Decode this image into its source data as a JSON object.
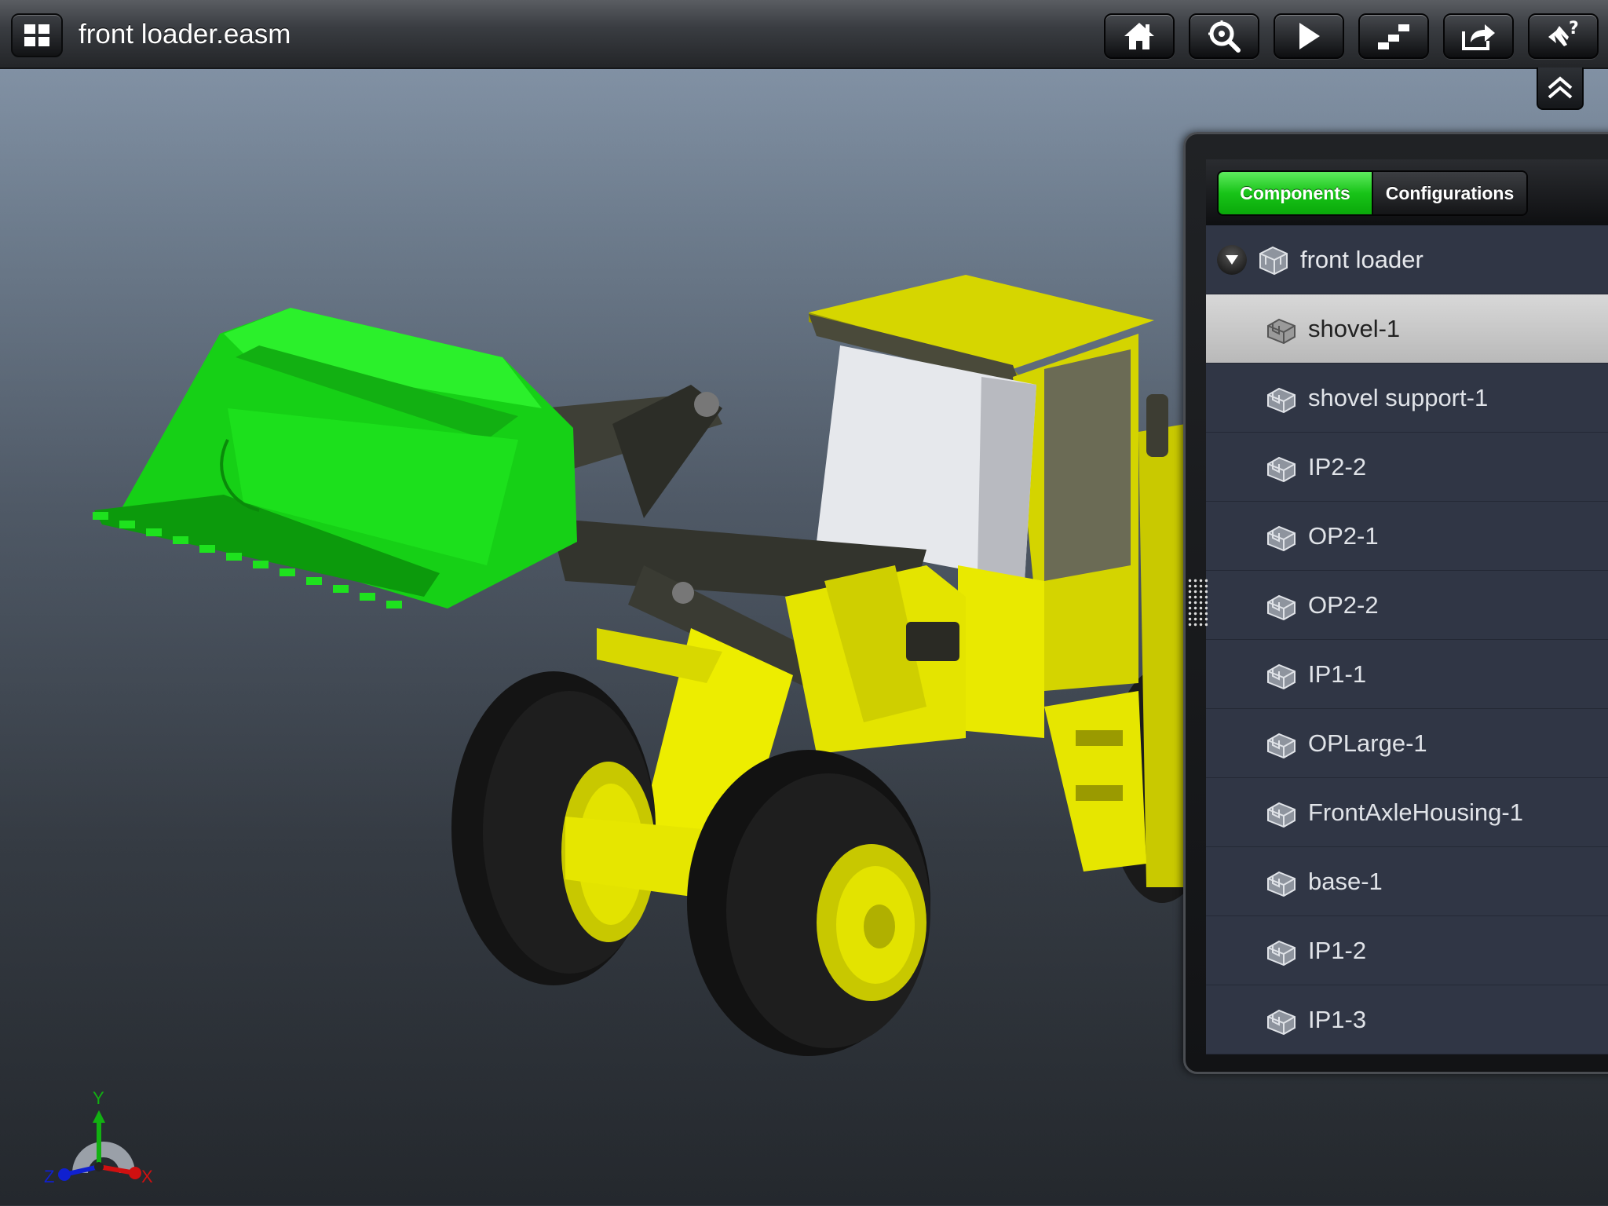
{
  "header": {
    "document_title": "front loader.easm",
    "buttons": [
      {
        "icon": "home-icon"
      },
      {
        "icon": "zoom-fit-icon"
      },
      {
        "icon": "play-icon"
      },
      {
        "icon": "explode-icon"
      },
      {
        "icon": "share-icon"
      },
      {
        "icon": "help-gesture-icon"
      }
    ]
  },
  "panel": {
    "tabs": {
      "components": "Components",
      "configurations": "Configurations",
      "active": "Components"
    },
    "root": {
      "label": "front loader",
      "expanded": true
    },
    "items": [
      {
        "label": "shovel-1",
        "selected": true
      },
      {
        "label": "shovel support-1",
        "selected": false
      },
      {
        "label": "IP2-2",
        "selected": false
      },
      {
        "label": "OP2-1",
        "selected": false
      },
      {
        "label": "OP2-2",
        "selected": false
      },
      {
        "label": "IP1-1",
        "selected": false
      },
      {
        "label": "OPLarge-1",
        "selected": false
      },
      {
        "label": "FrontAxleHousing-1",
        "selected": false
      },
      {
        "label": "base-1",
        "selected": false
      },
      {
        "label": "IP1-2",
        "selected": false
      },
      {
        "label": "IP1-3",
        "selected": false
      }
    ]
  },
  "triad": {
    "x": "X",
    "y": "Y",
    "z": "Z"
  },
  "colors": {
    "selected_part": "#1fe01f",
    "body": "#e6e600",
    "accent_green": "#18c418"
  }
}
